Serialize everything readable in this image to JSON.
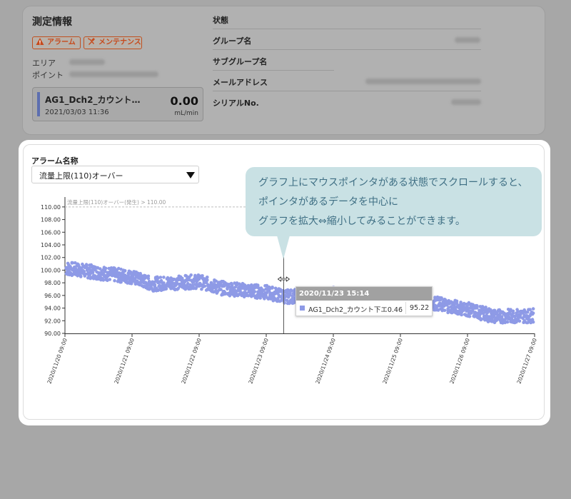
{
  "info": {
    "title": "測定情報",
    "badges": [
      {
        "label": "アラーム",
        "icon": "warning-icon"
      },
      {
        "label": "メンテナンス",
        "icon": "tools-icon"
      }
    ],
    "area_label": "エリア",
    "point_label": "ポイント",
    "sensor": {
      "name": "AG1_Dch2_カウント…",
      "date": "2021/03/03 11:36",
      "value": "0.00",
      "unit": "mL/min"
    },
    "right_labels": [
      "状態",
      "グループ名",
      "サブグループ名",
      "メールアドレス",
      "シリアルNo."
    ]
  },
  "alarm": {
    "label": "アラーム名称",
    "selected": "流量上限(110)オーバー"
  },
  "callout": {
    "lines": [
      "グラフ上にマウスポインタがある状態でスクロールすると、",
      "ポインタがあるデータを中心に",
      "グラフを拡大⇔縮小してみることができます。"
    ]
  },
  "tooltip": {
    "title": "2020/11/23 15:14",
    "series": "AG1_Dch2_カウント下エ0.46",
    "value": "95.22"
  },
  "chart_data": {
    "type": "scatter",
    "threshold": {
      "label": "流量上限(110)オーバー(発生) > 110.00",
      "value": 110
    },
    "ylim": [
      90,
      111
    ],
    "yticks": [
      "90.00",
      "92.00",
      "94.00",
      "96.00",
      "98.00",
      "100.00",
      "102.00",
      "104.00",
      "106.00",
      "108.00",
      "110.00"
    ],
    "xticks": [
      "2020/11/20 09:00",
      "2020/11/21 09:00",
      "2020/11/22 09:00",
      "2020/11/23 09:00",
      "2020/11/24 09:00",
      "2020/11/25 09:00",
      "2020/11/26 09:00",
      "2020/11/27 09:00"
    ],
    "xlim_days": [
      0,
      7
    ],
    "cursor_day": 0.26,
    "series": [
      {
        "color": "#8e9ae6",
        "trend_days": [
          0,
          0.5,
          1,
          1.3,
          2,
          2.3,
          3,
          3.3,
          4,
          5,
          5.5,
          6,
          6.4,
          7
        ],
        "trend_values": [
          100.3,
          99.6,
          98.9,
          97.8,
          98.2,
          97.2,
          96.5,
          95.8,
          96.2,
          95.2,
          94.8,
          93.8,
          92.7,
          92.8
        ],
        "band": 1.1
      }
    ]
  }
}
